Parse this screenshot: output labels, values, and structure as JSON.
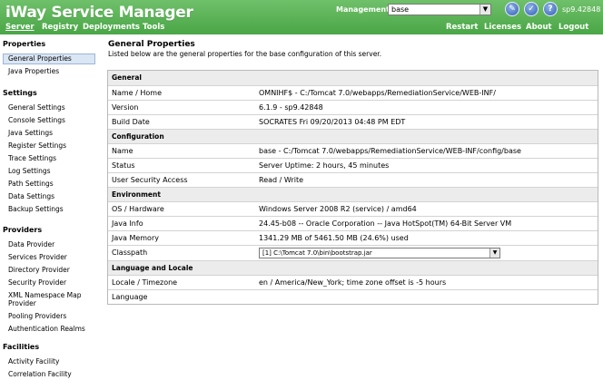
{
  "header": {
    "brand": "iWay Service Manager",
    "management_label": "Management",
    "management_value": "base",
    "version": "sp9.42848",
    "nav_left": [
      "Server",
      "Registry",
      "Deployments",
      "Tools"
    ],
    "nav_right": [
      "Restart",
      "Licenses",
      "About",
      "Logout"
    ]
  },
  "sidebar": {
    "sections": [
      {
        "title": "Properties",
        "items": [
          "General Properties",
          "Java Properties"
        ]
      },
      {
        "title": "Settings",
        "items": [
          "General Settings",
          "Console Settings",
          "Java Settings",
          "Register Settings",
          "Trace Settings",
          "Log Settings",
          "Path Settings",
          "Data Settings",
          "Backup Settings"
        ]
      },
      {
        "title": "Providers",
        "items": [
          "Data Provider",
          "Services Provider",
          "Directory Provider",
          "Security Provider",
          "XML Namespace Map",
          "Provider",
          "Pooling Providers",
          "Authentication Realms"
        ]
      },
      {
        "title": "Facilities",
        "items": [
          "Activity Facility",
          "Correlation Facility"
        ]
      }
    ],
    "selected": "General Properties"
  },
  "main": {
    "title": "General Properties",
    "subtitle": "Listed below are the general properties for the base configuration of this server.",
    "groups": [
      {
        "title": "General",
        "rows": [
          {
            "label": "Name / Home",
            "value": "OMNIHF$ - C:/Tomcat 7.0/webapps/RemediationService/WEB-INF/"
          },
          {
            "label": "Version",
            "value": "6.1.9 - sp9.42848"
          },
          {
            "label": "Build Date",
            "value": "SOCRATES Fri 09/20/2013 04:48 PM EDT"
          }
        ]
      },
      {
        "title": "Configuration",
        "rows": [
          {
            "label": "Name",
            "value": "base - C:/Tomcat 7.0/webapps/RemediationService/WEB-INF/config/base"
          },
          {
            "label": "Status",
            "value": "Server Uptime: 2 hours, 45 minutes"
          },
          {
            "label": "User Security Access",
            "value": "Read / Write"
          }
        ]
      },
      {
        "title": "Environment",
        "rows": [
          {
            "label": "OS / Hardware",
            "value": "Windows Server 2008 R2 (service) / amd64"
          },
          {
            "label": "Java Info",
            "value": "24.45-b08 -- Oracle Corporation -- Java HotSpot(TM) 64-Bit Server VM"
          },
          {
            "label": "Java Memory",
            "value": "1341.29 MB of 5461.50 MB (24.6%) used"
          },
          {
            "label": "Classpath",
            "value": "[1] C:\\Tomcat 7.0\\bin\\bootstrap.jar"
          }
        ]
      },
      {
        "title": "Language and Locale",
        "rows": [
          {
            "label": "Locale / Timezone",
            "value": "en / America/New_York; time zone offset is -5 hours"
          },
          {
            "label": "Language",
            "value": ""
          }
        ]
      }
    ]
  },
  "colors": {
    "header_green": "#4aa646",
    "selected_bg": "#dbe6f4",
    "group_bg": "#ececec"
  }
}
